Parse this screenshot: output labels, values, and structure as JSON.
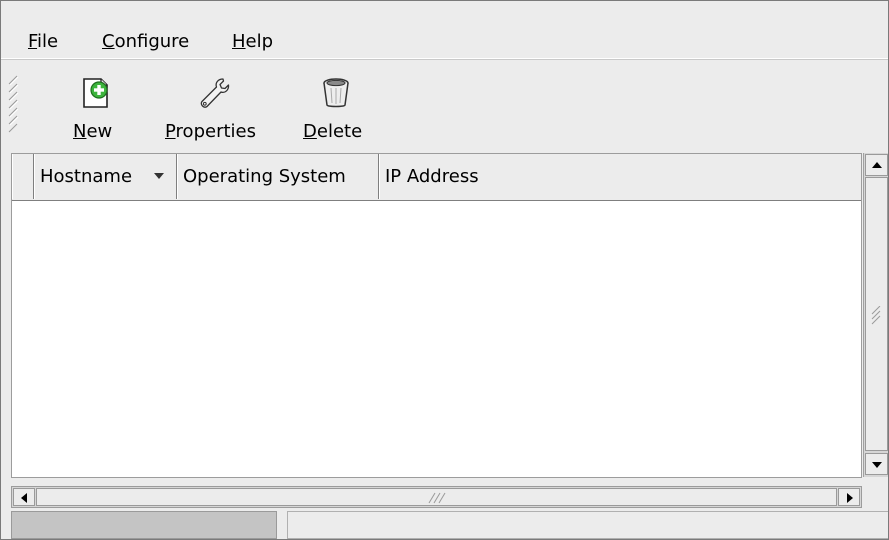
{
  "menubar": {
    "items": [
      {
        "mnemonic": "F",
        "rest": "ile"
      },
      {
        "mnemonic": "C",
        "rest": "onfigure"
      },
      {
        "mnemonic": "H",
        "rest": "elp"
      }
    ]
  },
  "toolbar": {
    "new": {
      "mnemonic": "N",
      "rest": "ew",
      "icon": "new-document-icon"
    },
    "properties": {
      "mnemonic": "P",
      "rest": "roperties",
      "icon": "wrench-icon"
    },
    "delete": {
      "mnemonic": "D",
      "rest": "elete",
      "icon": "trash-icon"
    }
  },
  "list": {
    "columns": [
      "Hostname",
      "Operating System",
      "IP Address"
    ],
    "sort_column": "Hostname",
    "sort_direction": "descending",
    "rows": []
  },
  "statusbar": {
    "text": ""
  },
  "colors": {
    "window_bg": "#ececec",
    "list_bg": "#ffffff",
    "new_icon_accent": "#3cb43c"
  }
}
